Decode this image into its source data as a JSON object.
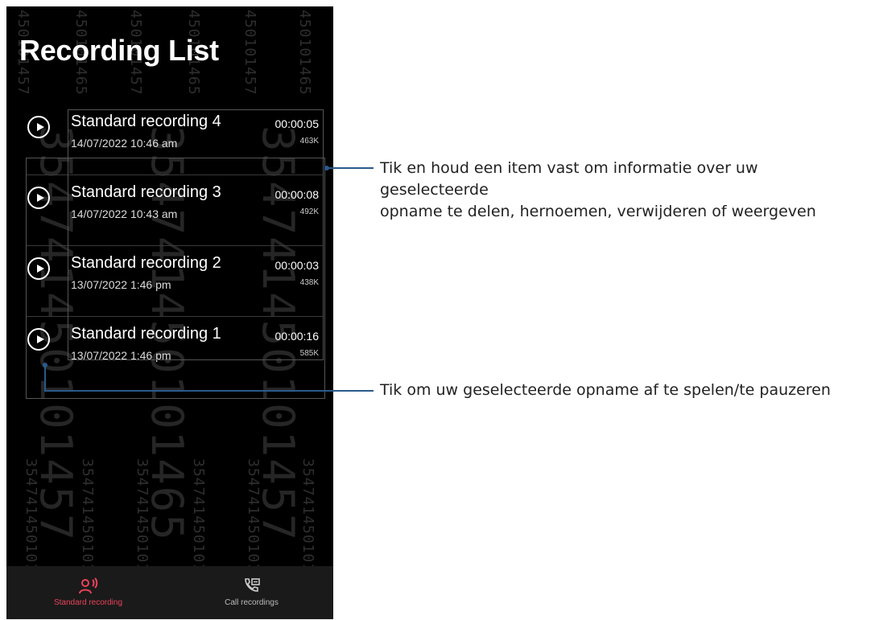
{
  "screen": {
    "title": "Recording List"
  },
  "watermark": {
    "small": "450101457",
    "small_alt": "450101465",
    "big": "354741450101457",
    "big_alt": "354741450101465",
    "bottom": "354741450101465"
  },
  "recordings": [
    {
      "name": "Standard recording 4",
      "date": "14/07/2022 10:46 am",
      "duration": "00:00:05",
      "size": "463K"
    },
    {
      "name": "Standard recording 3",
      "date": "14/07/2022 10:43 am",
      "duration": "00:00:08",
      "size": "492K"
    },
    {
      "name": "Standard recording 2",
      "date": "13/07/2022 1:46 pm",
      "duration": "00:00:03",
      "size": "438K"
    },
    {
      "name": "Standard recording 1",
      "date": "13/07/2022 1:46 pm",
      "duration": "00:00:16",
      "size": "585K"
    }
  ],
  "bottom_nav": {
    "tabs": [
      {
        "label": "Standard recording",
        "icon": "mic-wave-icon",
        "active": true,
        "color": "#e8435a"
      },
      {
        "label": "Call recordings",
        "icon": "call-recording-icon",
        "active": false,
        "color": "#bbbbbb"
      }
    ]
  },
  "callouts": {
    "long_press_line1": "Tik en houd een item vast om informatie over uw geselecteerde",
    "long_press_line2": "opname te delen, hernoemen, verwijderen of weergeven",
    "play_pause": "Tik om uw geselecteerde opname af te spelen/te pauzeren"
  },
  "colors": {
    "accent": "#e8435a",
    "callout_line": "#2a5a8c",
    "background": "#000000"
  }
}
